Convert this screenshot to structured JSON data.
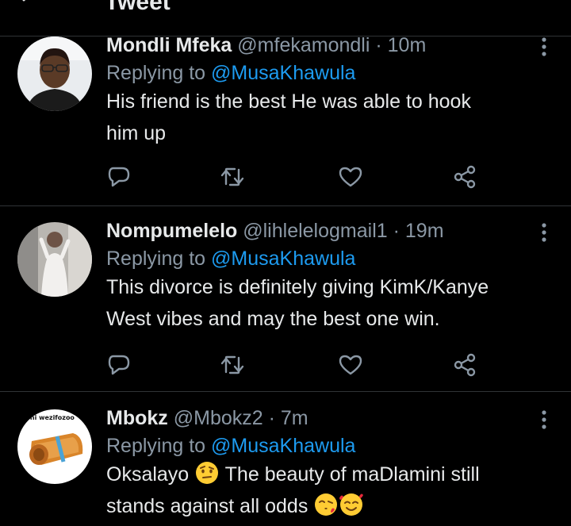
{
  "header": {
    "title": "Tweet",
    "back_icon": "arrow-left-icon"
  },
  "colors": {
    "background": "#000000",
    "text": "#e7e9ea",
    "muted": "#8b98a5",
    "link": "#1d9bf0",
    "divider": "#2f3336"
  },
  "replies": [
    {
      "name": "Mondli Mfeka",
      "handle": "@mfekamondli",
      "dot": "·",
      "time": "10m",
      "replying_prefix": "Replying to ",
      "replying_to": "@MusaKhawula",
      "text_line1": "His friend is the best He was able to hook",
      "text_line2": "him up"
    },
    {
      "name": "Nompumelelo",
      "handle": "@lihlelelogmail1",
      "dot": "·",
      "time": "19m",
      "replying_prefix": "Replying to ",
      "replying_to": "@MusaKhawula",
      "text_line1": "This divorce is definitely giving KimK/Kanye",
      "text_line2": "West vibes and may the best one win."
    },
    {
      "name": "Mbokz",
      "handle": "@Mbokz2",
      "dot": "·",
      "time": "7m",
      "replying_prefix": "Replying to ",
      "replying_to": "@MusaKhawula",
      "text_line1_a": "Oksalayo ",
      "text_line1_b": " The beauty of maDlamini still",
      "text_line2": "stands against all odds ",
      "avatar_caption": "laphi wezifozoo"
    }
  ],
  "icons": {
    "reply": "reply-icon",
    "retweet": "retweet-icon",
    "like": "heart-icon",
    "share": "share-icon",
    "more": "more-icon"
  }
}
